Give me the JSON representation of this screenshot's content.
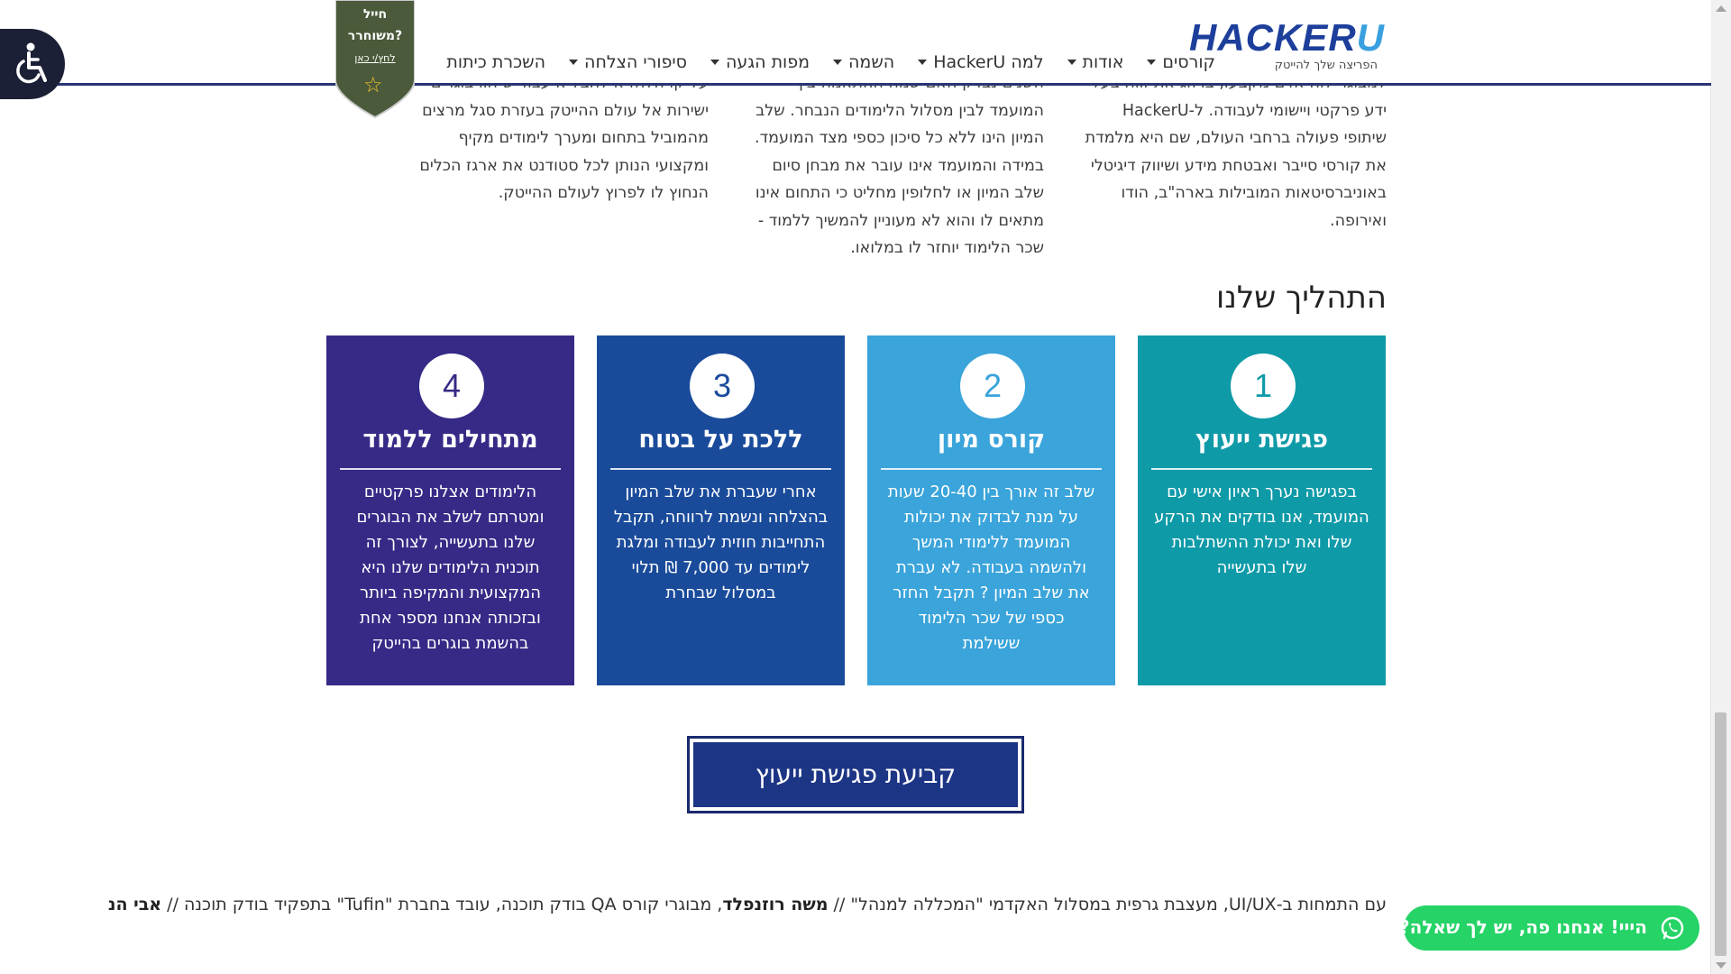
{
  "header": {
    "logo_text": "HACKERU",
    "logo_tagline": "הפריצה שלך להייטק",
    "nav": [
      {
        "label": "קורסים",
        "has_dropdown": true
      },
      {
        "label": "אודות",
        "has_dropdown": true
      },
      {
        "label": "למה HackerU",
        "has_dropdown": true
      },
      {
        "label": "השמה",
        "has_dropdown": true
      },
      {
        "label": "מפות הגעה",
        "has_dropdown": true
      },
      {
        "label": "סיפורי הצלחה",
        "has_dropdown": true
      },
      {
        "label": "השכרת כיתות",
        "has_dropdown": false
      }
    ]
  },
  "veteran_badge": {
    "line1": "חייל",
    "line2": "משוחרר?",
    "link": "לחץ/י כאן",
    "icon": "star-icon"
  },
  "accessibility": {
    "icon": "wheelchair-icon"
  },
  "columns": {
    "right": [
      "למבוגר לוח אזים מקבעו, ברוזג את זווח בעל",
      "ידע פרקטי ויישומי לעבודה. ל-HackerU",
      "שיתופי פעולה ברחבי העולם, שם היא מלמדת",
      "את קורסי סייבר ואבטחת מידע ושיווק דיגיטלי",
      "באוניברסיטאות המובילות בארה\"ב, הודו",
      "ואירופה."
    ],
    "middle": [
      "השנים נבדק האם שמה ההתאמה בין",
      "המועמד לבין מסלול הלימודים הנבחר. שלב",
      "המיון הינו ללא כל סיכון כספי מצד המועמד.",
      "במידה והמועמד אינו עובר את מבחן סיום",
      "שלב המיון או לחלופין מחליט כי התחום אינו",
      "מתאים לו והוא לא מעוניין להמשיך ללמוד -",
      "שכר הלימוד יוחזר לו במלואו."
    ],
    "left": [
      "על קו הלחז א לחבל א עבוד ש חוו בוגרים",
      "ישירות אל עולם ההייטק בעזרת סגל מרצים",
      "מהמוביל בתחום ומערך לימודים מקיף",
      "ומקצועי הנותן לכל סטודנט את ארגז הכלים",
      "הנחוץ לו לפרוץ לעולם ההייטק."
    ]
  },
  "process": {
    "title": "התהליך שלנו",
    "steps": [
      {
        "number": "1",
        "title": "פגישת ייעוץ",
        "color": "#0f9aa8",
        "lines": [
          "בפגישה נערך ראיון אישי עם",
          "המועמד, אנו בודקים את הרקע",
          "שלו ואת יכולת ההשתלבות",
          "שלו בתעשייה"
        ]
      },
      {
        "number": "2",
        "title": "קורס מיון",
        "color": "#3aa4db",
        "lines": [
          "שלב זה אורך בין 20-40 שעות",
          "על מנת לבדוק את יכולות",
          "המועמד ללימודי המשך",
          "ולהשמה בעבודה. לא עברת",
          "את שלב המיון ? תקבל החזר",
          "כספי של שכר הלימוד",
          "ששילמת"
        ]
      },
      {
        "number": "3",
        "title": "ללכת על בטוח",
        "color": "#1a4b9b",
        "lines": [
          "אחרי שעברת את שלב המיון",
          "בהצלחה ונשמת לרווחה, תקבל",
          "התחייבות חוזית לעבודה ומלגת",
          "לימודים עד 7,000 ₪ תלוי",
          "במסלול שבחרת"
        ]
      },
      {
        "number": "4",
        "title": "מתחילים ללמוד",
        "color": "#352a86",
        "lines": [
          "הלימודים אצלנו פרקטיים",
          "ומטרתם לשלב את הבוגרים",
          "שלנו בתעשייה, לצורך זה",
          "תוכנית הלימודים שלנו היא",
          "המקצועית והמקיפה ביותר",
          "ובזכותה אנחנו מספר אחת",
          "בהשמת בוגרים בהייטק"
        ]
      }
    ]
  },
  "cta": {
    "label": "קביעת פגישת ייעוץ"
  },
  "ticker": {
    "pre": "עם התמחות ב-UI/UX, מעצבת גרפית במסלול האקדמי \"המכללה למנהל\"  //  ",
    "name1": "משה רוזנפלד",
    "mid": ", מבוגרי קורס QA בודק תוכנה, עובד בחברת \"Tufin\" בתפקיד בודק תוכנה  //  ",
    "name2": "אבי הנ"
  },
  "whatsapp": {
    "label": "הייי! אנחנו פה, יש לך שאלה?",
    "icon": "whatsapp-icon"
  }
}
